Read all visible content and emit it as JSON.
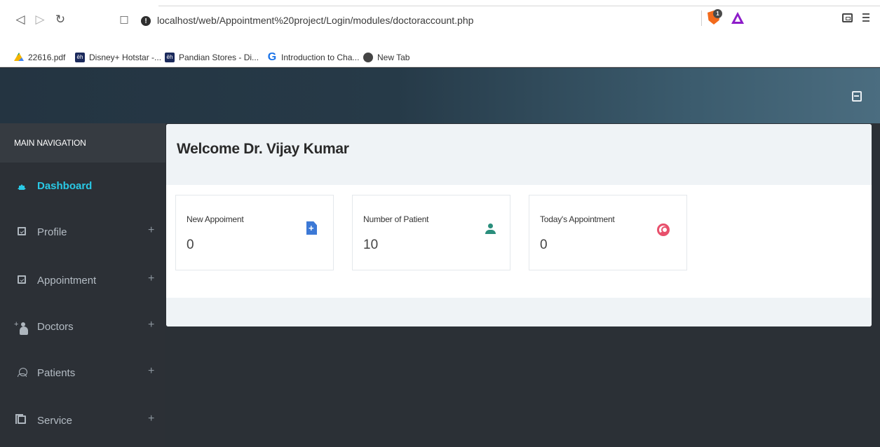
{
  "browser": {
    "url": "localhost/web/Appointment%20project/Login/modules/doctoraccount.php",
    "shield_count": "1",
    "bookmarks": [
      {
        "label": "22616.pdf",
        "icon": "google-drive-icon"
      },
      {
        "label": "Disney+ Hotstar -...",
        "icon": "hotstar-icon",
        "glyph": "ēh"
      },
      {
        "label": "Pandian Stores - Di...",
        "icon": "hotstar-icon",
        "glyph": "ēh"
      },
      {
        "label": "Introduction to Cha...",
        "icon": "g-icon",
        "glyph": "G"
      },
      {
        "label": "New Tab",
        "icon": "globe-icon"
      }
    ]
  },
  "sidebar": {
    "header": "MAIN NAVIGATION",
    "items": [
      {
        "label": "Dashboard",
        "icon": "home-icon",
        "plus": "",
        "active": true
      },
      {
        "label": "Profile",
        "icon": "calendar-check-icon",
        "plus": "+"
      },
      {
        "label": "Appointment",
        "icon": "calendar-check-icon",
        "plus": "+"
      },
      {
        "label": "Doctors",
        "icon": "user-plus-icon",
        "plus": "+"
      },
      {
        "label": "Patients",
        "icon": "user-icon",
        "plus": "+"
      },
      {
        "label": "Service",
        "icon": "copy-icon",
        "plus": "+"
      }
    ]
  },
  "main": {
    "welcome": "Welcome Dr. Vijay Kumar",
    "stats": [
      {
        "label": "New Appoiment",
        "value": "0",
        "icon": "file-plus-icon",
        "color": "#3c79d6"
      },
      {
        "label": "Number of Patient",
        "value": "10",
        "icon": "person-icon",
        "color": "#2a8e7c"
      },
      {
        "label": "Today's Appointment",
        "value": "0",
        "icon": "user-circle-icon",
        "color": "#e8506c"
      }
    ]
  },
  "colors": {
    "accent": "#29c9e6",
    "sidebar": "#2c3036",
    "header_start": "#243441",
    "header_end": "#4b6d80"
  }
}
